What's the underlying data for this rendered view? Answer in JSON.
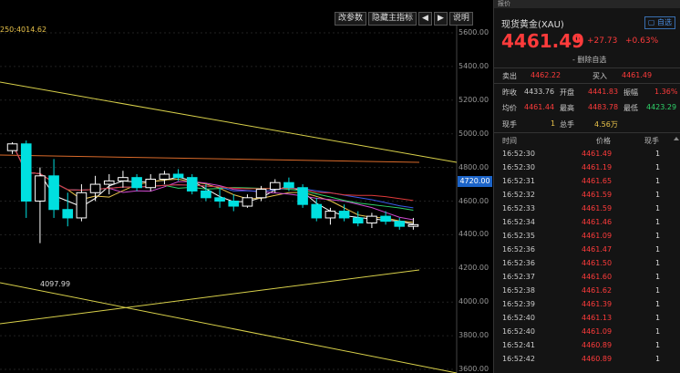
{
  "toolbar": {
    "settings_label": "改参数",
    "hide_label": "隐藏主指标",
    "prev_icon": "arrow-left",
    "next_icon": "arrow-right",
    "help_label": "说明"
  },
  "ma_label": "250:4014.62",
  "axis": {
    "labels": [
      "5600.00",
      "5400.00",
      "5200.00",
      "5000.00",
      "4800.00",
      "4600.00",
      "4400.00",
      "4200.00",
      "4000.00",
      "3800.00",
      "3600.00"
    ]
  },
  "current_price_tag": "4720.00",
  "low_label": "4097.99",
  "panel": {
    "top_tab": "报价",
    "title": "现货黄金(XAU)",
    "watch_label": "自选",
    "price": "4461.49",
    "change": "+27.73",
    "change_pct": "+0.63%",
    "del_watch": "- 删除自选"
  },
  "quote": {
    "sell_label": "卖出",
    "sell": "4462.22",
    "buy_label": "买入",
    "buy": "4461.49",
    "prevclose_label": "昨收",
    "prevclose": "4433.76",
    "open_label": "开盘",
    "open": "4441.83",
    "amp_label": "振幅",
    "amp": "1.36%",
    "avg_label": "均价",
    "avg": "4461.44",
    "high_label": "最高",
    "high": "4483.78",
    "low_label": "最低",
    "low": "4423.29",
    "nowvol_label": "现手",
    "nowvol": "1",
    "totalvol_label": "总手",
    "totalvol": "4.56万"
  },
  "ticks_header": {
    "time": "时间",
    "price": "价格",
    "vol": "现手"
  },
  "ticks": [
    {
      "time": "16:52:30",
      "price": "4461.49",
      "vol": "1"
    },
    {
      "time": "16:52:30",
      "price": "4461.19",
      "vol": "1"
    },
    {
      "time": "16:52:31",
      "price": "4461.65",
      "vol": "1"
    },
    {
      "time": "16:52:32",
      "price": "4461.59",
      "vol": "1"
    },
    {
      "time": "16:52:33",
      "price": "4461.59",
      "vol": "1"
    },
    {
      "time": "16:52:34",
      "price": "4461.46",
      "vol": "1"
    },
    {
      "time": "16:52:35",
      "price": "4461.09",
      "vol": "1"
    },
    {
      "time": "16:52:36",
      "price": "4461.47",
      "vol": "1"
    },
    {
      "time": "16:52:36",
      "price": "4461.50",
      "vol": "1"
    },
    {
      "time": "16:52:37",
      "price": "4461.60",
      "vol": "1"
    },
    {
      "time": "16:52:38",
      "price": "4461.62",
      "vol": "1"
    },
    {
      "time": "16:52:39",
      "price": "4461.39",
      "vol": "1"
    },
    {
      "time": "16:52:40",
      "price": "4461.13",
      "vol": "1"
    },
    {
      "time": "16:52:40",
      "price": "4461.09",
      "vol": "1"
    },
    {
      "time": "16:52:41",
      "price": "4460.89",
      "vol": "1"
    },
    {
      "time": "16:52:42",
      "price": "4460.89",
      "vol": "1"
    }
  ],
  "chart_data": {
    "type": "candlestick",
    "ylim": [
      3600,
      5600
    ],
    "y_ticks": [
      5600,
      5400,
      5200,
      5000,
      4800,
      4600,
      4400,
      4200,
      4000,
      3800,
      3600
    ],
    "series": [
      {
        "name": "candles",
        "values": [
          [
            4900,
            4950,
            4880,
            4940
          ],
          [
            4940,
            4960,
            4500,
            4600
          ],
          [
            4600,
            4800,
            4350,
            4750
          ],
          [
            4750,
            4850,
            4500,
            4550
          ],
          [
            4550,
            4650,
            4450,
            4500
          ],
          [
            4500,
            4700,
            4480,
            4650
          ],
          [
            4650,
            4750,
            4600,
            4700
          ],
          [
            4700,
            4760,
            4640,
            4720
          ],
          [
            4720,
            4780,
            4680,
            4740
          ],
          [
            4740,
            4760,
            4660,
            4680
          ],
          [
            4680,
            4760,
            4660,
            4730
          ],
          [
            4730,
            4780,
            4700,
            4760
          ],
          [
            4760,
            4790,
            4720,
            4740
          ],
          [
            4740,
            4760,
            4640,
            4660
          ],
          [
            4660,
            4700,
            4600,
            4620
          ],
          [
            4620,
            4680,
            4560,
            4600
          ],
          [
            4600,
            4640,
            4540,
            4570
          ],
          [
            4570,
            4640,
            4560,
            4620
          ],
          [
            4620,
            4690,
            4600,
            4670
          ],
          [
            4670,
            4730,
            4650,
            4710
          ],
          [
            4710,
            4740,
            4660,
            4680
          ],
          [
            4680,
            4700,
            4560,
            4580
          ],
          [
            4580,
            4620,
            4480,
            4500
          ],
          [
            4500,
            4560,
            4460,
            4540
          ],
          [
            4540,
            4580,
            4480,
            4500
          ],
          [
            4500,
            4540,
            4450,
            4470
          ],
          [
            4470,
            4530,
            4440,
            4510
          ],
          [
            4510,
            4540,
            4460,
            4480
          ],
          [
            4480,
            4500,
            4430,
            4450
          ],
          [
            4450,
            4500,
            4430,
            4460
          ]
        ]
      }
    ]
  }
}
